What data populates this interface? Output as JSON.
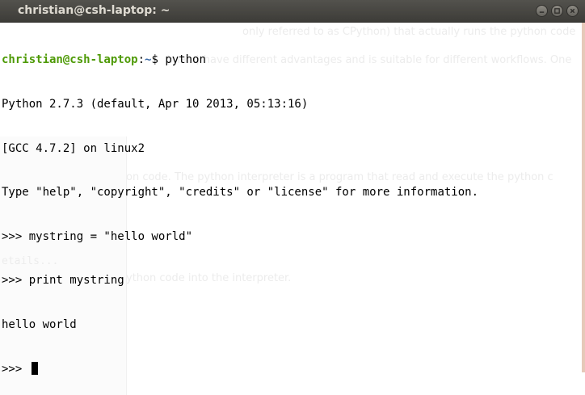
{
  "window": {
    "title": "christian@csh-laptop: ~",
    "controls": [
      "minimize-icon",
      "maximize-icon",
      "close-icon"
    ]
  },
  "terminal": {
    "prompt": {
      "user_host": "christian@csh-laptop",
      "separator": ":",
      "path": "~",
      "symbol": "$ ",
      "command": "python"
    },
    "output": [
      "Python 2.7.3 (default, Apr 10 2013, 05:13:16)",
      "[GCC 4.7.2] on linux2",
      "Type \"help\", \"copyright\", \"credits\" or \"license\" for more information.",
      ">>> mystring = \"hello world\"",
      ">>> print mystring",
      "hello world"
    ],
    "repl_prompt": ">>> "
  },
  "background_text": {
    "line1": "only referred to as CPython) that actually runs the python code",
    "line2": "(main) have different advantages and is suitable for different workflows. One",
    "line3": "on code. The python interpreter is a program that read and execute the python c",
    "line4": "etails...",
    "line5": "ython code into the interpreter."
  },
  "colors": {
    "titlebar": "#3d3c38",
    "title_text": "#dfdbd2",
    "prompt_user": "#4e9a06",
    "prompt_path": "#3465a4",
    "terminal_bg": "#ffffff",
    "terminal_fg": "#000000"
  }
}
